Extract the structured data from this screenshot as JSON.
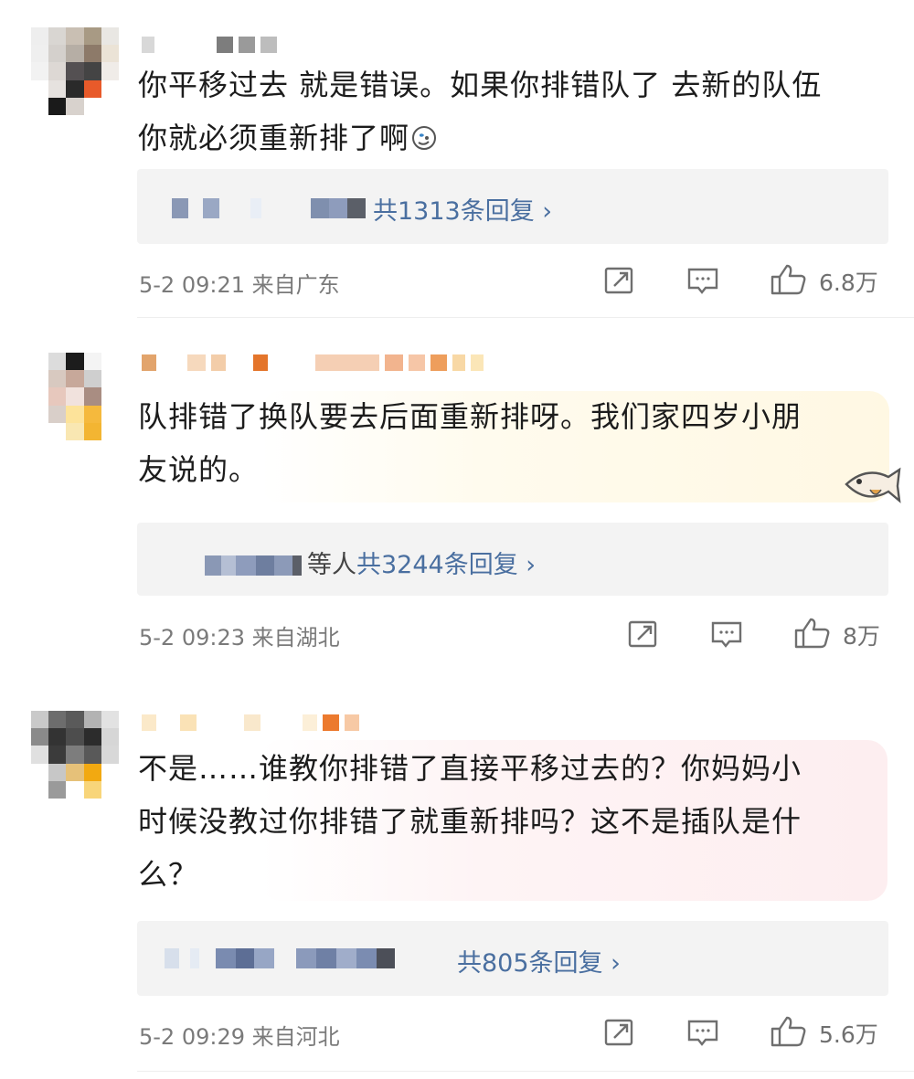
{
  "comments": [
    {
      "text_line1": "你平移过去 就是错误。如果你排错队了 去新的队伍",
      "text_line2": "你就必须重新排了啊",
      "emoji": "dizzy-face-emoji",
      "reply_summary": "共1313条回复 ›",
      "time_location": "5-2 09:21 来自广东",
      "likes": "6.8万"
    },
    {
      "text_line1": "队排错了换队要去后面重新排呀。我们家四岁小朋",
      "text_line2": "友说的。",
      "sticker": "fish-sticker",
      "reply_prefix": "等人",
      "reply_summary": "共3244条回复 ›",
      "time_location": "5-2 09:23 来自湖北",
      "likes": "8万"
    },
    {
      "text_line1": "不是……谁教你排错了直接平移过去的？你妈妈小",
      "text_line2": "时候没教过你排错了就重新排吗？这不是插队是什",
      "text_line3": "么？",
      "reply_summary": "共805条回复 ›",
      "time_location": "5-2 09:29 来自河北",
      "likes": "5.6万"
    }
  ],
  "icons": {
    "share": "share-icon",
    "comment": "comment-icon",
    "like": "like-icon"
  },
  "colors": {
    "reply_link": "#4a6fa0",
    "meta_text": "#7a7a7a",
    "reply_bg": "#f3f3f3"
  }
}
